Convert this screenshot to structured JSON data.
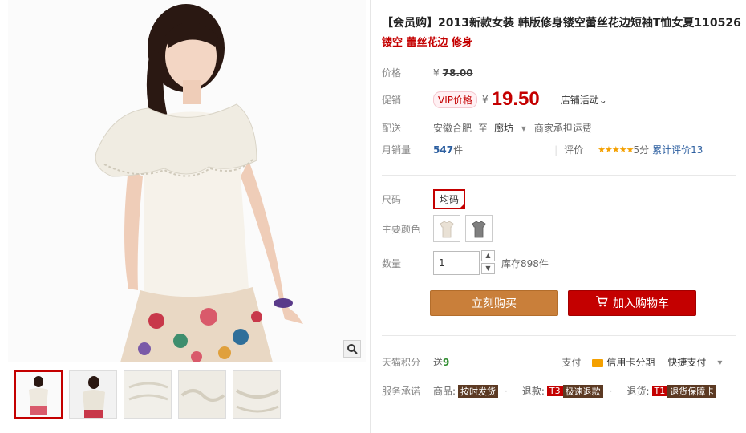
{
  "product": {
    "title": "【会员购】2013新款女装 韩版修身镂空蕾丝花边短袖T恤女夏110526",
    "subtitle": "镂空 蕾丝花边 修身"
  },
  "price": {
    "label": "价格",
    "currency": "¥",
    "original": "78.00"
  },
  "promo": {
    "label": "促销",
    "badge": "VIP价格",
    "currency": "¥",
    "value": "19.50",
    "store_activity": "店铺活动",
    "store_activity_arrow": "⌄"
  },
  "delivery": {
    "label": "配送",
    "from": "安徽合肥",
    "to_word": "至",
    "to": "廊坊",
    "dropdown": "▾",
    "shipping": "商家承担运费"
  },
  "sales": {
    "label": "月销量",
    "count": "547",
    "unit": "件",
    "rating_label": "评价",
    "stars": "★★★★★",
    "score": "5分",
    "review_link": "累计评价13"
  },
  "size": {
    "label": "尺码",
    "option": "均码"
  },
  "color": {
    "label": "主要颜色"
  },
  "quantity": {
    "label": "数量",
    "value": "1",
    "up": "▲",
    "down": "▼",
    "stock": "库存898件"
  },
  "actions": {
    "buy_now": "立刻购买",
    "add_cart": "加入购物车"
  },
  "points": {
    "label": "天猫积分",
    "give": "送",
    "amount": "9",
    "pay_label": "支付",
    "credit_card": "信用卡分期",
    "quick_pay": "快捷支付",
    "quick_pay_arrow": "▾"
  },
  "service": {
    "label": "服务承诺",
    "goods_label": "商品:",
    "goods_tag": "按时发货",
    "refund_label": "退款:",
    "refund_code": "T3",
    "refund_tag": "极速退款",
    "return_label": "退货:",
    "return_code": "T1",
    "return_tag": "退货保障卡"
  },
  "icons": {
    "zoom": "magnifier-icon",
    "cart": "cart-icon",
    "card": "credit-card-icon"
  }
}
